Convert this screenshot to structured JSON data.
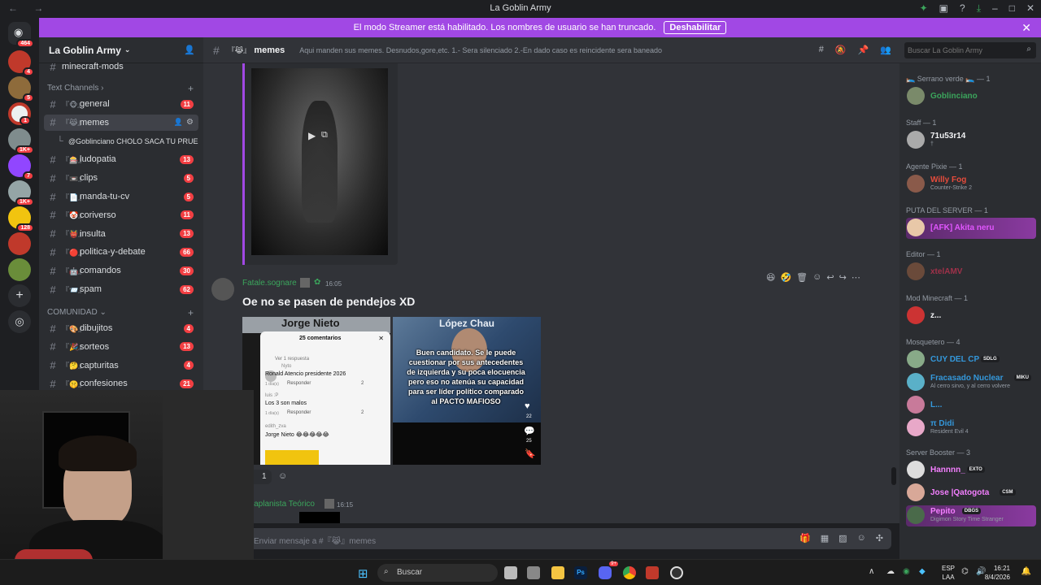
{
  "window": {
    "title": "La Goblin Army",
    "nav": "← →"
  },
  "banner": {
    "text": "El modo Streamer está habilitado. Los nombres de usuario se han truncado.",
    "button": "Deshabilitar",
    "close": "✕"
  },
  "guilds": {
    "dm_badge": "464",
    "badges": [
      "4",
      "5",
      "1",
      "1K+",
      "7",
      "1K+",
      "128"
    ]
  },
  "sidebar": {
    "server_name": "La Goblin Army",
    "top_channel": "minecraft-mods",
    "text_category": "Text Channels",
    "channels": [
      {
        "emoji": "『🐵』",
        "name": "general",
        "count": "11"
      },
      {
        "emoji": "『😹』",
        "name": "memes",
        "count": ""
      },
      {
        "emoji": "",
        "name": "@Goblinciano CHOLO SACA TU PRUE...",
        "count": ""
      },
      {
        "emoji": "『🎰』",
        "name": "ludopatia",
        "count": "13"
      },
      {
        "emoji": "『📼』",
        "name": "clips",
        "count": "5"
      },
      {
        "emoji": "『📄』",
        "name": "manda-tu-cv",
        "count": "5"
      },
      {
        "emoji": "『🤡』",
        "name": "coriverso",
        "count": "11"
      },
      {
        "emoji": "『👹』",
        "name": "insulta",
        "count": "13"
      },
      {
        "emoji": "『🔴』",
        "name": "politica-y-debate",
        "count": "66"
      },
      {
        "emoji": "『🤖』",
        "name": "comandos",
        "count": "30"
      },
      {
        "emoji": "『📨』",
        "name": "spam",
        "count": "62"
      }
    ],
    "community_category": "COMUNIDAD",
    "community_channels": [
      {
        "emoji": "『🎨』",
        "name": "dibujitos",
        "count": "4"
      },
      {
        "emoji": "『🎉』",
        "name": "sorteos",
        "count": "13"
      },
      {
        "emoji": "『🤔』",
        "name": "capturitas",
        "count": "4"
      },
      {
        "emoji": "『🤫』",
        "name": "confesiones",
        "count": "21"
      }
    ]
  },
  "header": {
    "channel_emoji": "『😹』",
    "channel": "memes",
    "topic": "Aqui manden sus memes. Desnudos,gore,etc. 1.- Sera silenciado 2.-En dado caso es reincidente sera baneado"
  },
  "search": {
    "placeholder": "Buscar La Goblin Army"
  },
  "message": {
    "author": "Fatale.sognare",
    "time": "16:05",
    "text": "Oe no se pasen de pendejos XD",
    "reaction_count": "1",
    "left_image": {
      "banner": "Jorge Nieto",
      "panel_title": "25 comentarios",
      "reply_toggle": "Ver 1 respuesta",
      "comments": [
        {
          "user": "Nyto",
          "text": "Ronald Atencio presidente 2026",
          "meta": "1 día(s)",
          "reply": "Responder",
          "likes": "2"
        },
        {
          "user": "luis :P",
          "text": "Los 3 son malos",
          "meta": "1 día(s)",
          "reply": "Responder",
          "likes": "2"
        },
        {
          "user": "edith_zva",
          "text": "Jorge Nieto 😂😂😂😂😂",
          "meta": "",
          "reply": "",
          "likes": ""
        }
      ]
    },
    "right_image": {
      "banner": "López Chau",
      "caption": "Buen candidato. Se le puede cuestionar por sus antecedentes de izquierda y su poca elocuencia pero eso no atenúa su capacidad para ser líder político comparado al PACTO MAFIOSO",
      "stats": [
        "22",
        "25"
      ]
    }
  },
  "next_message": {
    "author": "traplanista Teórico",
    "time": "16:15"
  },
  "composer": {
    "placeholder": "Enviar mensaje a #『😹』memes"
  },
  "members": {
    "groups": [
      {
        "role": "🛌 Serrano verde 🛌 — 1",
        "members": [
          {
            "name": "Goblinciano",
            "sub": "",
            "color": "#3ba55c"
          }
        ]
      },
      {
        "role": "Staff — 1",
        "members": [
          {
            "name": "71u53r14",
            "sub": "†",
            "color": "#f2f3f5"
          }
        ]
      },
      {
        "role": "Agente Pixie — 1",
        "members": [
          {
            "name": "Willy Fog",
            "sub": "Counter-Strike 2",
            "color": "#e74c3c"
          }
        ]
      },
      {
        "role": "PUTA DEL SERVER — 1",
        "members": [
          {
            "name": "[AFK] Akita neru",
            "sub": "",
            "color": "#e056fd"
          }
        ]
      },
      {
        "role": "Editor — 1",
        "members": [
          {
            "name": "xtelAMV",
            "sub": "",
            "color": "#a0314a"
          }
        ]
      },
      {
        "role": "Mod Minecraft — 1",
        "members": [
          {
            "name": "z...",
            "sub": "",
            "color": "#f2f3f5"
          }
        ]
      },
      {
        "role": "Mosquetero — 4",
        "members": [
          {
            "name": "CUY DEL CP",
            "tag": "SDLG",
            "sub": "",
            "color": "#3498db"
          },
          {
            "name": "Fracasado Nuclear",
            "tag": "MIKU",
            "sub": "Al cerro sirvo, y al cerro volvere",
            "color": "#3498db"
          },
          {
            "name": "L...",
            "sub": "",
            "color": "#3498db"
          },
          {
            "name": "π Didi",
            "sub": "Resident Evil 4",
            "color": "#3498db"
          }
        ]
      },
      {
        "role": "Server Booster — 3",
        "members": [
          {
            "name": "Hannnn_",
            "tag": "EXTO",
            "sub": "",
            "color": "#f47fff"
          },
          {
            "name": "Jose |Qatogota",
            "tag": "CSM",
            "sub": "",
            "color": "#f47fff"
          },
          {
            "name": "Pepito",
            "tag": "DBGS",
            "sub": "Digimon Story Time Stranger",
            "color": "#f47fff"
          }
        ]
      }
    ]
  },
  "taskbar": {
    "search": "Buscar",
    "lang_top": "ESP",
    "lang_bottom": "LAA",
    "time": "16:21",
    "date": "8/4/2026",
    "discord_badge": "9+"
  }
}
